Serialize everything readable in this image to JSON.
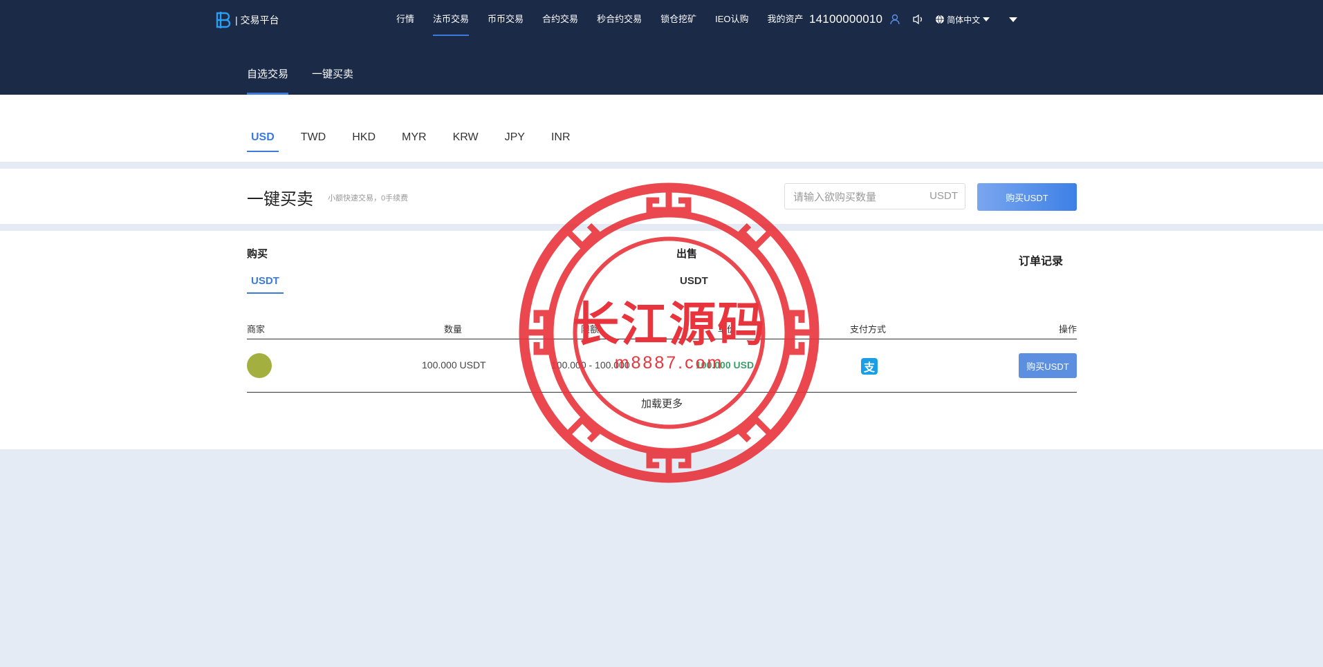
{
  "header": {
    "brand": "| 交易平台",
    "nav": [
      "行情",
      "法币交易",
      "币币交易",
      "合约交易",
      "秒合约交易",
      "锁仓挖矿",
      "IEO认购",
      "我的资产"
    ],
    "nav_active": "法币交易",
    "phone": "14100000010",
    "language": "简体中文",
    "subnav": [
      "自选交易",
      "一键买卖"
    ],
    "subnav_active": "自选交易"
  },
  "currency_tabs": [
    "USD",
    "TWD",
    "HKD",
    "MYR",
    "KRW",
    "JPY",
    "INR"
  ],
  "currency_active": "USD",
  "quick_trade": {
    "title": "一键买卖",
    "subtitle": "小额快速交易，0手续费",
    "input_placeholder": "请输入欲购买数量",
    "unit": "USDT",
    "button": "购买USDT"
  },
  "market": {
    "buy_heading": "购买",
    "buy_coin": "USDT",
    "sell_heading": "出售",
    "sell_coin": "USDT",
    "order_records": "订单记录",
    "columns": [
      "商家",
      "数量",
      "限额",
      "单价",
      "支付方式",
      "操作"
    ],
    "rows": [
      {
        "quantity": "100.000 USDT",
        "limit": "100.000 - 100.000",
        "price": "100.000 USD",
        "payment": "alipay-icon",
        "payment_glyph": "支",
        "action": "购买USDT"
      }
    ],
    "load_more": "加载更多"
  },
  "watermark": {
    "title": "长江源码",
    "site": "m8887.com",
    "color": "#e8343c"
  },
  "colors": {
    "header_bg": "#1b2a47",
    "accent": "#3a7bdc",
    "page_bg": "#e4ebf4",
    "price": "#3c9e6b"
  }
}
